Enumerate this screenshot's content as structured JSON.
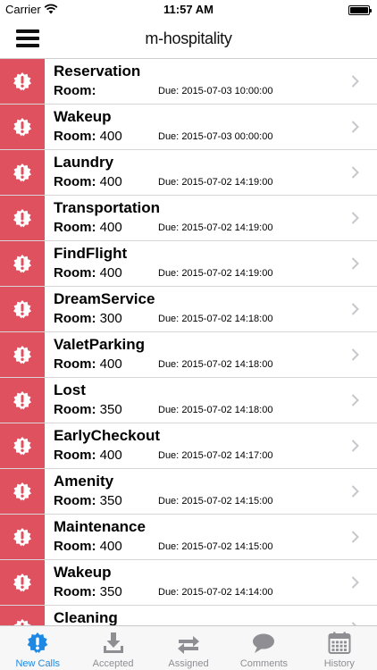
{
  "status_bar": {
    "carrier": "Carrier",
    "time": "11:57 AM"
  },
  "nav": {
    "title": "m-hospitality"
  },
  "colors": {
    "alert": "#e0515f",
    "tab_active": "#1e88e5",
    "tab_inactive": "#8e8e93"
  },
  "room_label": "Room:",
  "due_label": "Due:",
  "calls": [
    {
      "type": "Reservation",
      "room": "",
      "due": "2015-07-03 10:00:00"
    },
    {
      "type": "Wakeup",
      "room": "400",
      "due": "2015-07-03 00:00:00"
    },
    {
      "type": "Laundry",
      "room": "400",
      "due": "2015-07-02 14:19:00"
    },
    {
      "type": "Transportation",
      "room": "400",
      "due": "2015-07-02 14:19:00"
    },
    {
      "type": "FindFlight",
      "room": "400",
      "due": "2015-07-02 14:19:00"
    },
    {
      "type": "DreamService",
      "room": "300",
      "due": "2015-07-02 14:18:00"
    },
    {
      "type": "ValetParking",
      "room": "400",
      "due": "2015-07-02 14:18:00"
    },
    {
      "type": "Lost",
      "room": "350",
      "due": "2015-07-02 14:18:00"
    },
    {
      "type": "EarlyCheckout",
      "room": "400",
      "due": "2015-07-02 14:17:00"
    },
    {
      "type": "Amenity",
      "room": "350",
      "due": "2015-07-02 14:15:00"
    },
    {
      "type": "Maintenance",
      "room": "400",
      "due": "2015-07-02 14:15:00"
    },
    {
      "type": "Wakeup",
      "room": "350",
      "due": "2015-07-02 14:14:00"
    },
    {
      "type": "Cleaning",
      "room": "",
      "due": ""
    }
  ],
  "tabs": [
    {
      "label": "New Calls",
      "icon": "alert-badge-icon",
      "active": true
    },
    {
      "label": "Accepted",
      "icon": "download-tray-icon",
      "active": false
    },
    {
      "label": "Assigned",
      "icon": "swap-arrows-icon",
      "active": false
    },
    {
      "label": "Comments",
      "icon": "speech-bubble-icon",
      "active": false
    },
    {
      "label": "History",
      "icon": "calendar-icon",
      "active": false
    }
  ]
}
